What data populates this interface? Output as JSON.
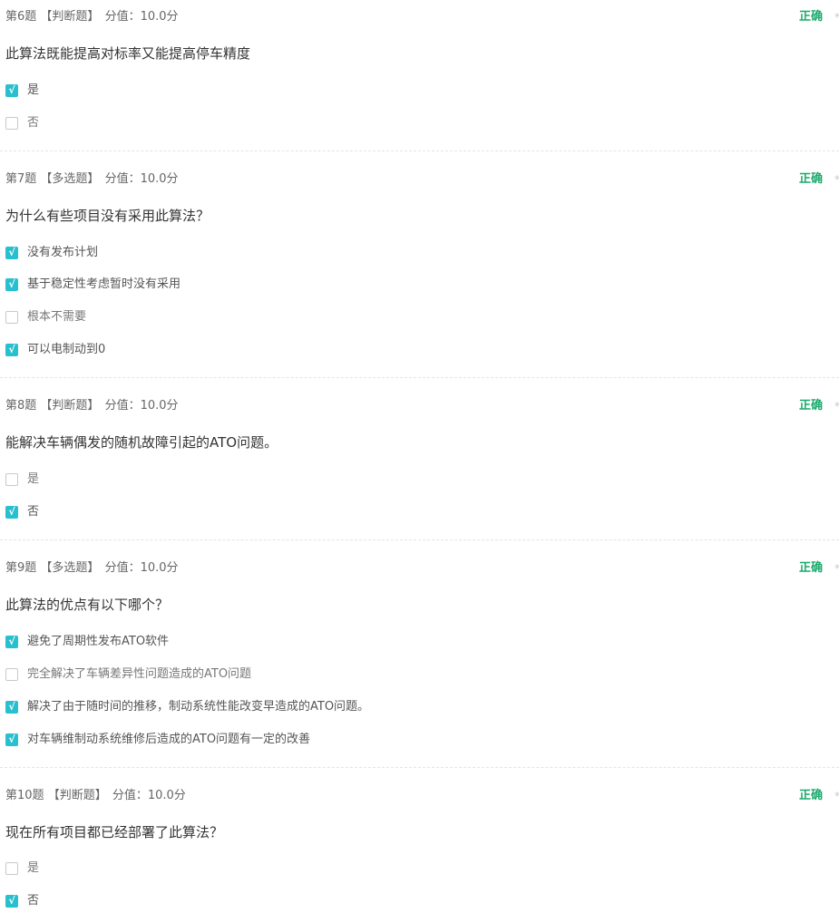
{
  "status_check_glyph": "√",
  "questions": [
    {
      "number": "第6题",
      "type": "【判断题】",
      "score": "分值：10.0分",
      "status": "正确",
      "edge_glyph": "*",
      "text": "此算法既能提高对标率又能提高停车精度",
      "options": [
        {
          "label": "是",
          "checked": true
        },
        {
          "label": "否",
          "checked": false
        }
      ]
    },
    {
      "number": "第7题",
      "type": "【多选题】",
      "score": "分值：10.0分",
      "status": "正确",
      "edge_glyph": "*",
      "text": "为什么有些项目没有采用此算法？",
      "options": [
        {
          "label": "没有发布计划",
          "checked": true
        },
        {
          "label": "基于稳定性考虑暂时没有采用",
          "checked": true
        },
        {
          "label": "根本不需要",
          "checked": false
        },
        {
          "label": "可以电制动到0",
          "checked": true
        }
      ]
    },
    {
      "number": "第8题",
      "type": "【判断题】",
      "score": "分值：10.0分",
      "status": "正确",
      "edge_glyph": "*",
      "text": "能解决车辆偶发的随机故障引起的ATO问题。",
      "options": [
        {
          "label": "是",
          "checked": false
        },
        {
          "label": "否",
          "checked": true
        }
      ]
    },
    {
      "number": "第9题",
      "type": "【多选题】",
      "score": "分值：10.0分",
      "status": "正确",
      "edge_glyph": "*",
      "text": "此算法的优点有以下哪个？",
      "options": [
        {
          "label": "避免了周期性发布ATO软件",
          "checked": true
        },
        {
          "label": "完全解决了车辆差异性问题造成的ATO问题",
          "checked": false
        },
        {
          "label": "解决了由于随时间的推移，制动系统性能改变早造成的ATO问题。",
          "checked": true
        },
        {
          "label": "对车辆维制动系统维修后造成的ATO问题有一定的改善",
          "checked": true
        }
      ]
    },
    {
      "number": "第10题",
      "type": "【判断题】",
      "score": "分值：10.0分",
      "status": "正确",
      "edge_glyph": "*",
      "text": "现在所有项目都已经部署了此算法？",
      "options": [
        {
          "label": "是",
          "checked": false
        },
        {
          "label": "否",
          "checked": true
        }
      ]
    }
  ]
}
